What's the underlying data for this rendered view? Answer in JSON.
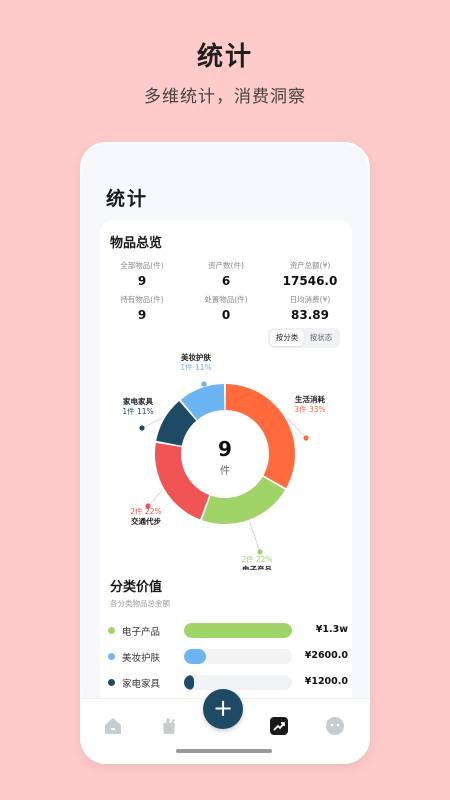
{
  "promo": {
    "title": "统计",
    "subtitle": "多维统计，消费洞察"
  },
  "screen": {
    "title": "统计"
  },
  "overview": {
    "title": "物品总览",
    "stats": [
      {
        "label": "全部物品(件)",
        "value": "9"
      },
      {
        "label": "资产数(件)",
        "value": "6"
      },
      {
        "label": "资产总额(¥)",
        "value": "17546.0"
      },
      {
        "label": "持有物品(件)",
        "value": "9"
      },
      {
        "label": "处置物品(件)",
        "value": "0"
      },
      {
        "label": "日均消费(¥)",
        "value": "83.89"
      }
    ],
    "toggle": {
      "by_category": "按分类",
      "by_status": "按状态"
    }
  },
  "chart_data": {
    "type": "pie",
    "donut": true,
    "center_value": "9",
    "center_unit": "件",
    "categories": [
      "生活消耗",
      "电子产品",
      "交通代步",
      "家电家具",
      "美妆护肤"
    ],
    "values": [
      3,
      2,
      2,
      1,
      1
    ],
    "labels": [
      "3件 33%",
      "2件 22%",
      "2件 22%",
      "1件 11%",
      "1件 11%"
    ],
    "colors": [
      "#FF6B3D",
      "#A0D468",
      "#F05454",
      "#1E4A66",
      "#6CB4F2"
    ]
  },
  "category_value": {
    "title": "分类价值",
    "subtitle": "各分类物品总金额",
    "rows": [
      {
        "name": "电子产品",
        "amount": "¥1.3w",
        "fraction": 1.0,
        "color": "#A0D468"
      },
      {
        "name": "美妆护肤",
        "amount": "¥2600.0",
        "fraction": 0.2,
        "color": "#6CB4F2"
      },
      {
        "name": "家电家具",
        "amount": "¥1200.0",
        "fraction": 0.09,
        "color": "#1E4A66"
      }
    ]
  },
  "tabbar": {
    "fab_label": "+"
  }
}
